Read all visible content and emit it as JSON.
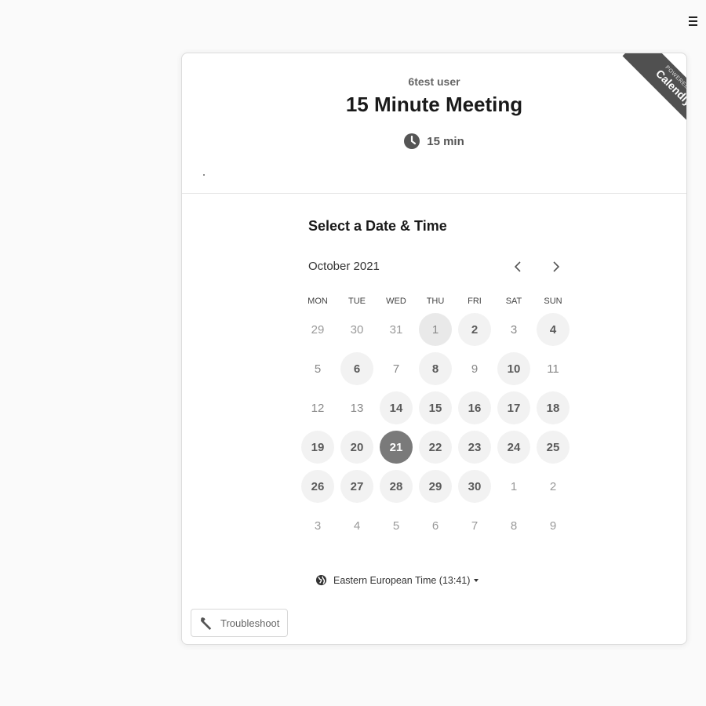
{
  "header": {
    "host": "6test user",
    "title": "15 Minute Meeting",
    "duration": "15 min",
    "badge": {
      "small": "POWERED BY",
      "big": "Calendly"
    }
  },
  "scheduler": {
    "section_title": "Select a Date & Time",
    "month": "October 2021",
    "weekdays": [
      "MON",
      "TUE",
      "WED",
      "THU",
      "FRI",
      "SAT",
      "SUN"
    ],
    "days": [
      {
        "label": "29",
        "state": "muted"
      },
      {
        "label": "30",
        "state": "muted"
      },
      {
        "label": "31",
        "state": "muted"
      },
      {
        "label": "1",
        "state": "today"
      },
      {
        "label": "2",
        "state": "avail"
      },
      {
        "label": "3",
        "state": "unavail"
      },
      {
        "label": "4",
        "state": "avail"
      },
      {
        "label": "5",
        "state": "unavail"
      },
      {
        "label": "6",
        "state": "avail"
      },
      {
        "label": "7",
        "state": "unavail"
      },
      {
        "label": "8",
        "state": "avail"
      },
      {
        "label": "9",
        "state": "unavail"
      },
      {
        "label": "10",
        "state": "avail"
      },
      {
        "label": "11",
        "state": "unavail"
      },
      {
        "label": "12",
        "state": "unavail"
      },
      {
        "label": "13",
        "state": "unavail"
      },
      {
        "label": "14",
        "state": "avail"
      },
      {
        "label": "15",
        "state": "avail"
      },
      {
        "label": "16",
        "state": "avail"
      },
      {
        "label": "17",
        "state": "avail"
      },
      {
        "label": "18",
        "state": "avail"
      },
      {
        "label": "19",
        "state": "avail"
      },
      {
        "label": "20",
        "state": "avail"
      },
      {
        "label": "21",
        "state": "selected"
      },
      {
        "label": "22",
        "state": "avail"
      },
      {
        "label": "23",
        "state": "avail"
      },
      {
        "label": "24",
        "state": "avail"
      },
      {
        "label": "25",
        "state": "avail"
      },
      {
        "label": "26",
        "state": "avail"
      },
      {
        "label": "27",
        "state": "avail"
      },
      {
        "label": "28",
        "state": "avail"
      },
      {
        "label": "29",
        "state": "avail"
      },
      {
        "label": "30",
        "state": "avail"
      },
      {
        "label": "1",
        "state": "muted"
      },
      {
        "label": "2",
        "state": "muted"
      },
      {
        "label": "3",
        "state": "muted"
      },
      {
        "label": "4",
        "state": "muted"
      },
      {
        "label": "5",
        "state": "muted"
      },
      {
        "label": "6",
        "state": "muted"
      },
      {
        "label": "7",
        "state": "muted"
      },
      {
        "label": "8",
        "state": "muted"
      },
      {
        "label": "9",
        "state": "muted"
      }
    ],
    "timezone": "Eastern European Time (13:41)"
  },
  "footer": {
    "troubleshoot_label": "Troubleshoot"
  },
  "colors": {
    "selected": "#7a7a7a",
    "available_bg": "#f2f2f2",
    "badge": "#505050"
  }
}
